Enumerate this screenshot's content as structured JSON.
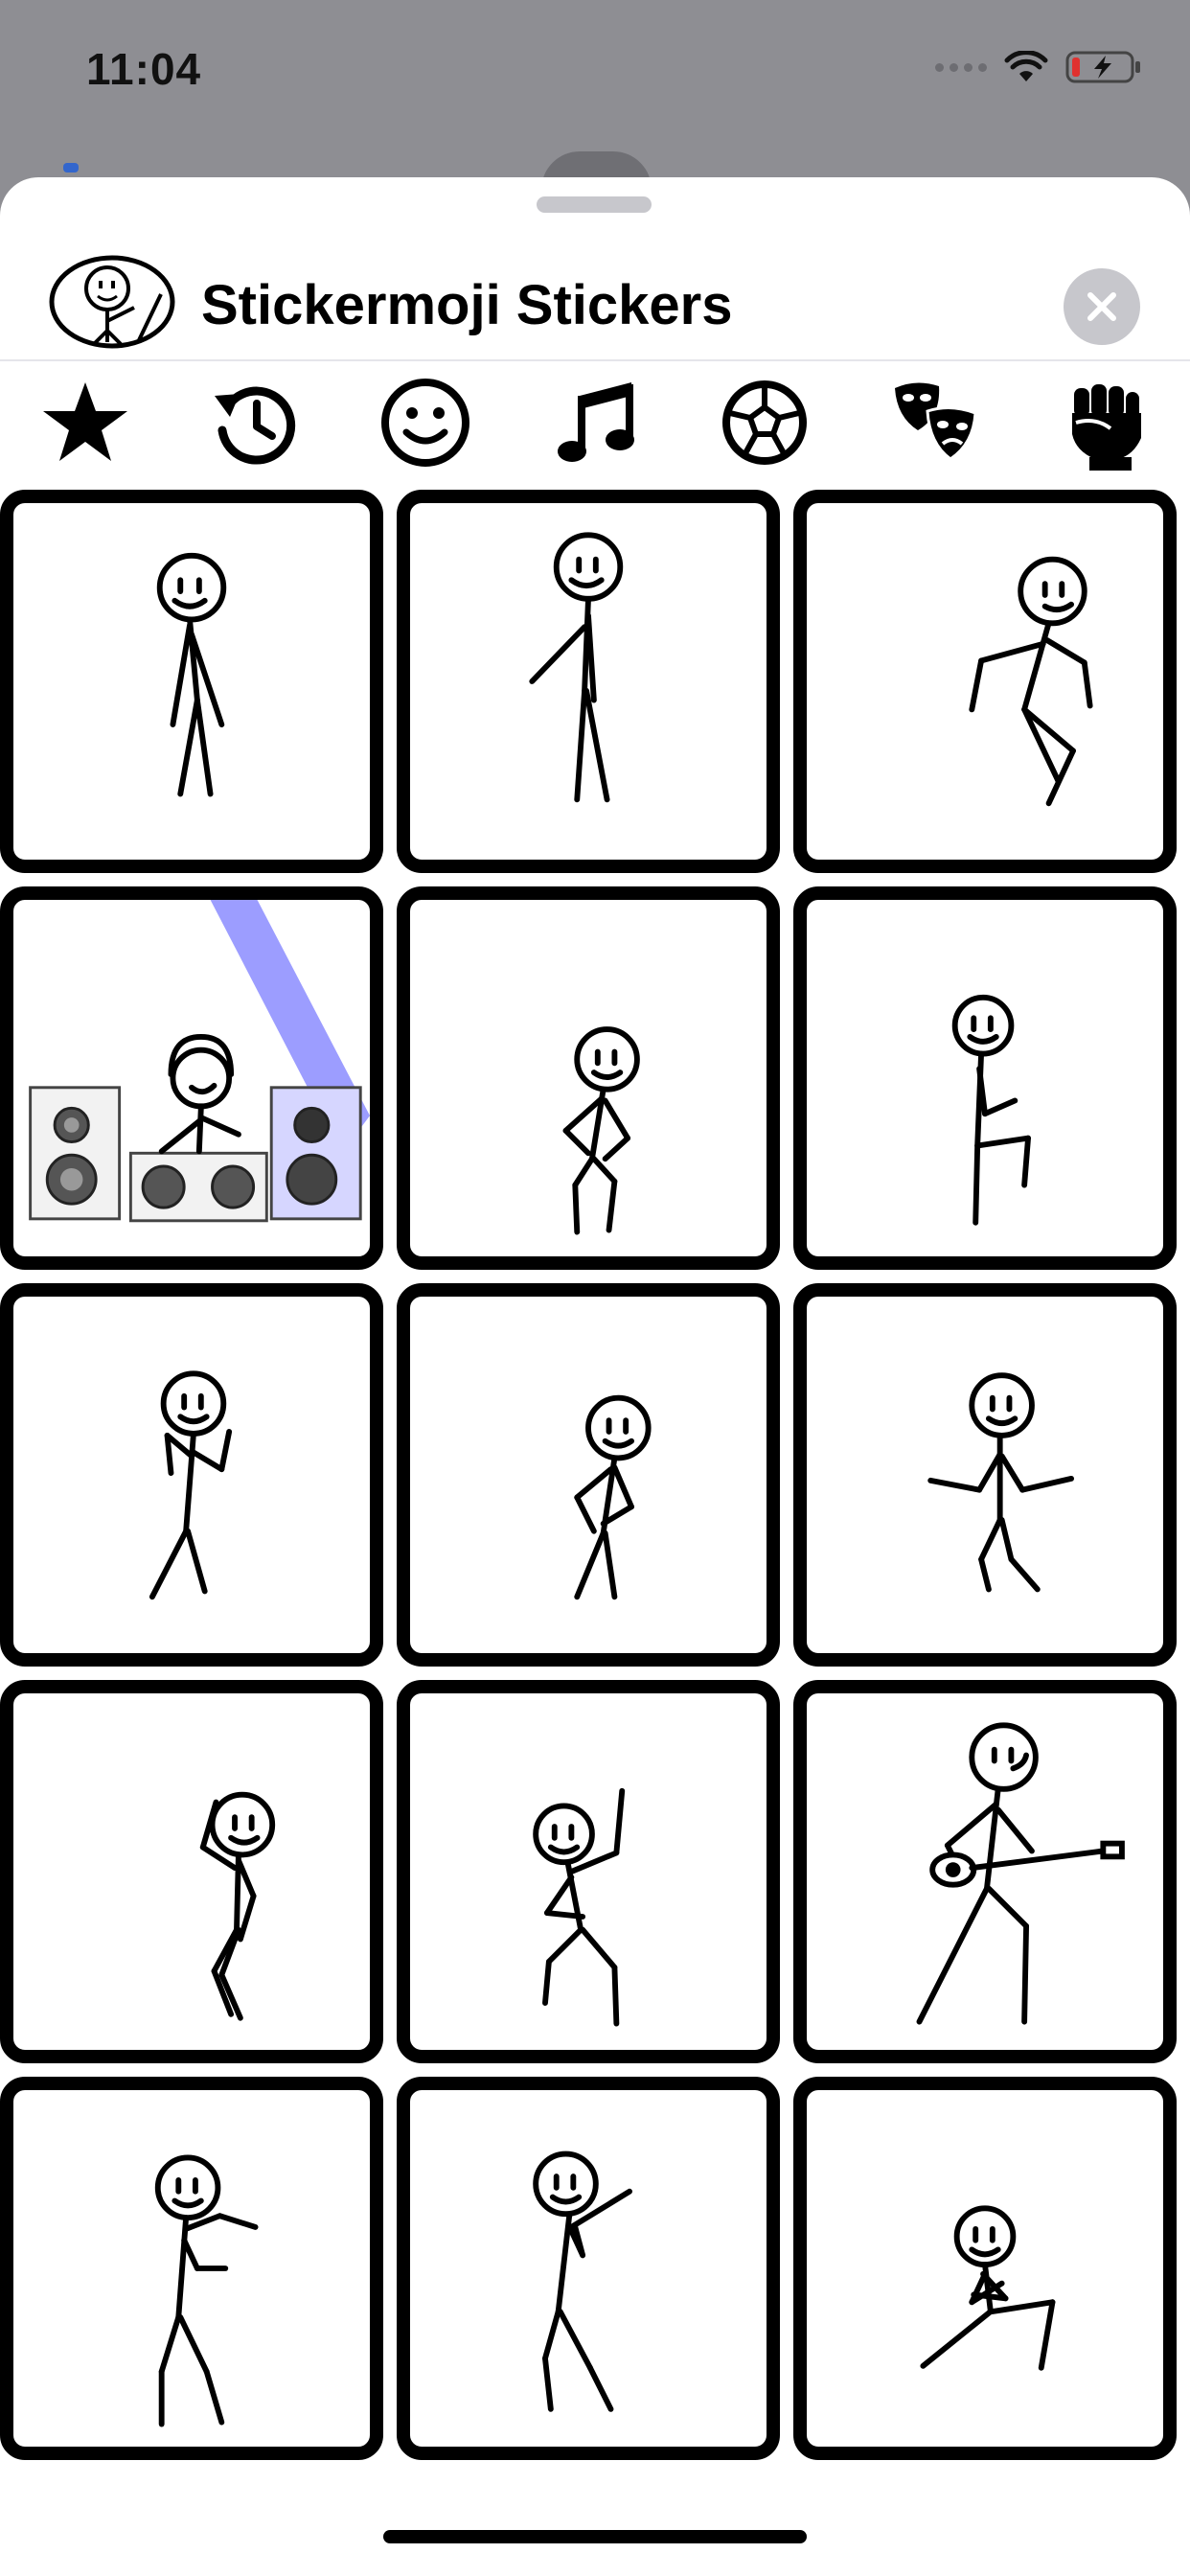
{
  "status_bar": {
    "time": "11:04"
  },
  "sheet": {
    "title": "Stickermoji Stickers"
  },
  "categories": [
    {
      "name": "favorites",
      "icon": "star-icon"
    },
    {
      "name": "recent",
      "icon": "history-icon"
    },
    {
      "name": "smileys",
      "icon": "smiley-icon"
    },
    {
      "name": "music",
      "icon": "music-note-icon"
    },
    {
      "name": "sports",
      "icon": "soccer-ball-icon"
    },
    {
      "name": "theater",
      "icon": "theater-masks-icon"
    },
    {
      "name": "power",
      "icon": "raised-fist-icon"
    }
  ],
  "stickers": [
    "stick-figure-standing",
    "stick-figure-leaning",
    "stick-figure-jumping",
    "stick-figure-dj",
    "stick-figure-hands-on-hips",
    "stick-figure-knee-up",
    "stick-figure-arms-up",
    "stick-figure-hip-sway",
    "stick-figure-arms-out",
    "stick-figure-hand-on-head",
    "stick-figure-waving",
    "stick-figure-guitar",
    "stick-figure-zombie",
    "stick-figure-pointing",
    "stick-figure-squat"
  ],
  "colors": {
    "accent": "#000000",
    "close_bg": "#c7c7cc",
    "dim": "#8e8e93",
    "spotlight": "#4a4cff"
  }
}
